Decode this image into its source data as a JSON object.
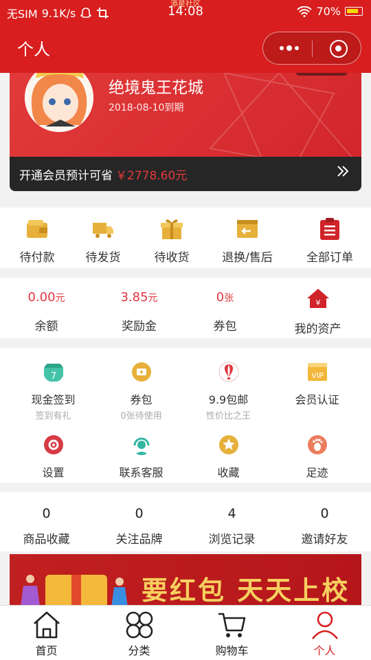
{
  "status_bar": {
    "carrier": "无SIM",
    "speed": "9.1K/s",
    "time": "14:08",
    "overlay": "添星社区",
    "battery": "70%"
  },
  "nav": {
    "title": "个人"
  },
  "member_card": {
    "name": "绝境鬼王花城",
    "expire": "2018-08-10到期",
    "promo_text": "开通会员预计可省",
    "promo_amount": "￥2778.60元"
  },
  "orders": [
    {
      "label": "待付款",
      "icon": "wallet-icon"
    },
    {
      "label": "待发货",
      "icon": "truck-icon"
    },
    {
      "label": "待收货",
      "icon": "gift-box-icon"
    },
    {
      "label": "退换/售后",
      "icon": "return-icon"
    },
    {
      "label": "全部订单",
      "icon": "order-list-icon"
    }
  ],
  "assets": [
    {
      "value": "0.00",
      "unit": "元",
      "label": "余额"
    },
    {
      "value": "3.85",
      "unit": "元",
      "label": "奖励金"
    },
    {
      "value": "0",
      "unit": "张",
      "label": "券包"
    },
    {
      "label": "我的资产",
      "icon": "house-yen-icon"
    }
  ],
  "tools": [
    {
      "label": "现金签到",
      "sub": "签到有礼",
      "icon": "calendar-icon"
    },
    {
      "label": "券包",
      "sub": "0张待使用",
      "icon": "ticket-icon"
    },
    {
      "label": "9.9包邮",
      "sub": "性价比之王",
      "icon": "balloon-icon"
    },
    {
      "label": "会员认证",
      "sub": "",
      "icon": "vip-icon"
    },
    {
      "label": "设置",
      "sub": "",
      "icon": "gear-icon"
    },
    {
      "label": "联系客服",
      "sub": "",
      "icon": "headset-icon"
    },
    {
      "label": "收藏",
      "sub": "",
      "icon": "star-icon"
    },
    {
      "label": "足迹",
      "sub": "",
      "icon": "footprint-icon"
    }
  ],
  "stats": [
    {
      "num": "0",
      "label": "商品收藏"
    },
    {
      "num": "0",
      "label": "关注品牌"
    },
    {
      "num": "4",
      "label": "浏览记录"
    },
    {
      "num": "0",
      "label": "邀请好友"
    }
  ],
  "banner": {
    "text": "要红包 天天上校品会"
  },
  "tabbar": [
    {
      "label": "首页",
      "icon": "home-icon"
    },
    {
      "label": "分类",
      "icon": "category-icon"
    },
    {
      "label": "购物车",
      "icon": "cart-icon"
    },
    {
      "label": "个人",
      "icon": "person-icon"
    }
  ],
  "colors": {
    "brand_red": "#d81e1e",
    "value_red": "#e0383e",
    "gold": "#e6b03a"
  }
}
